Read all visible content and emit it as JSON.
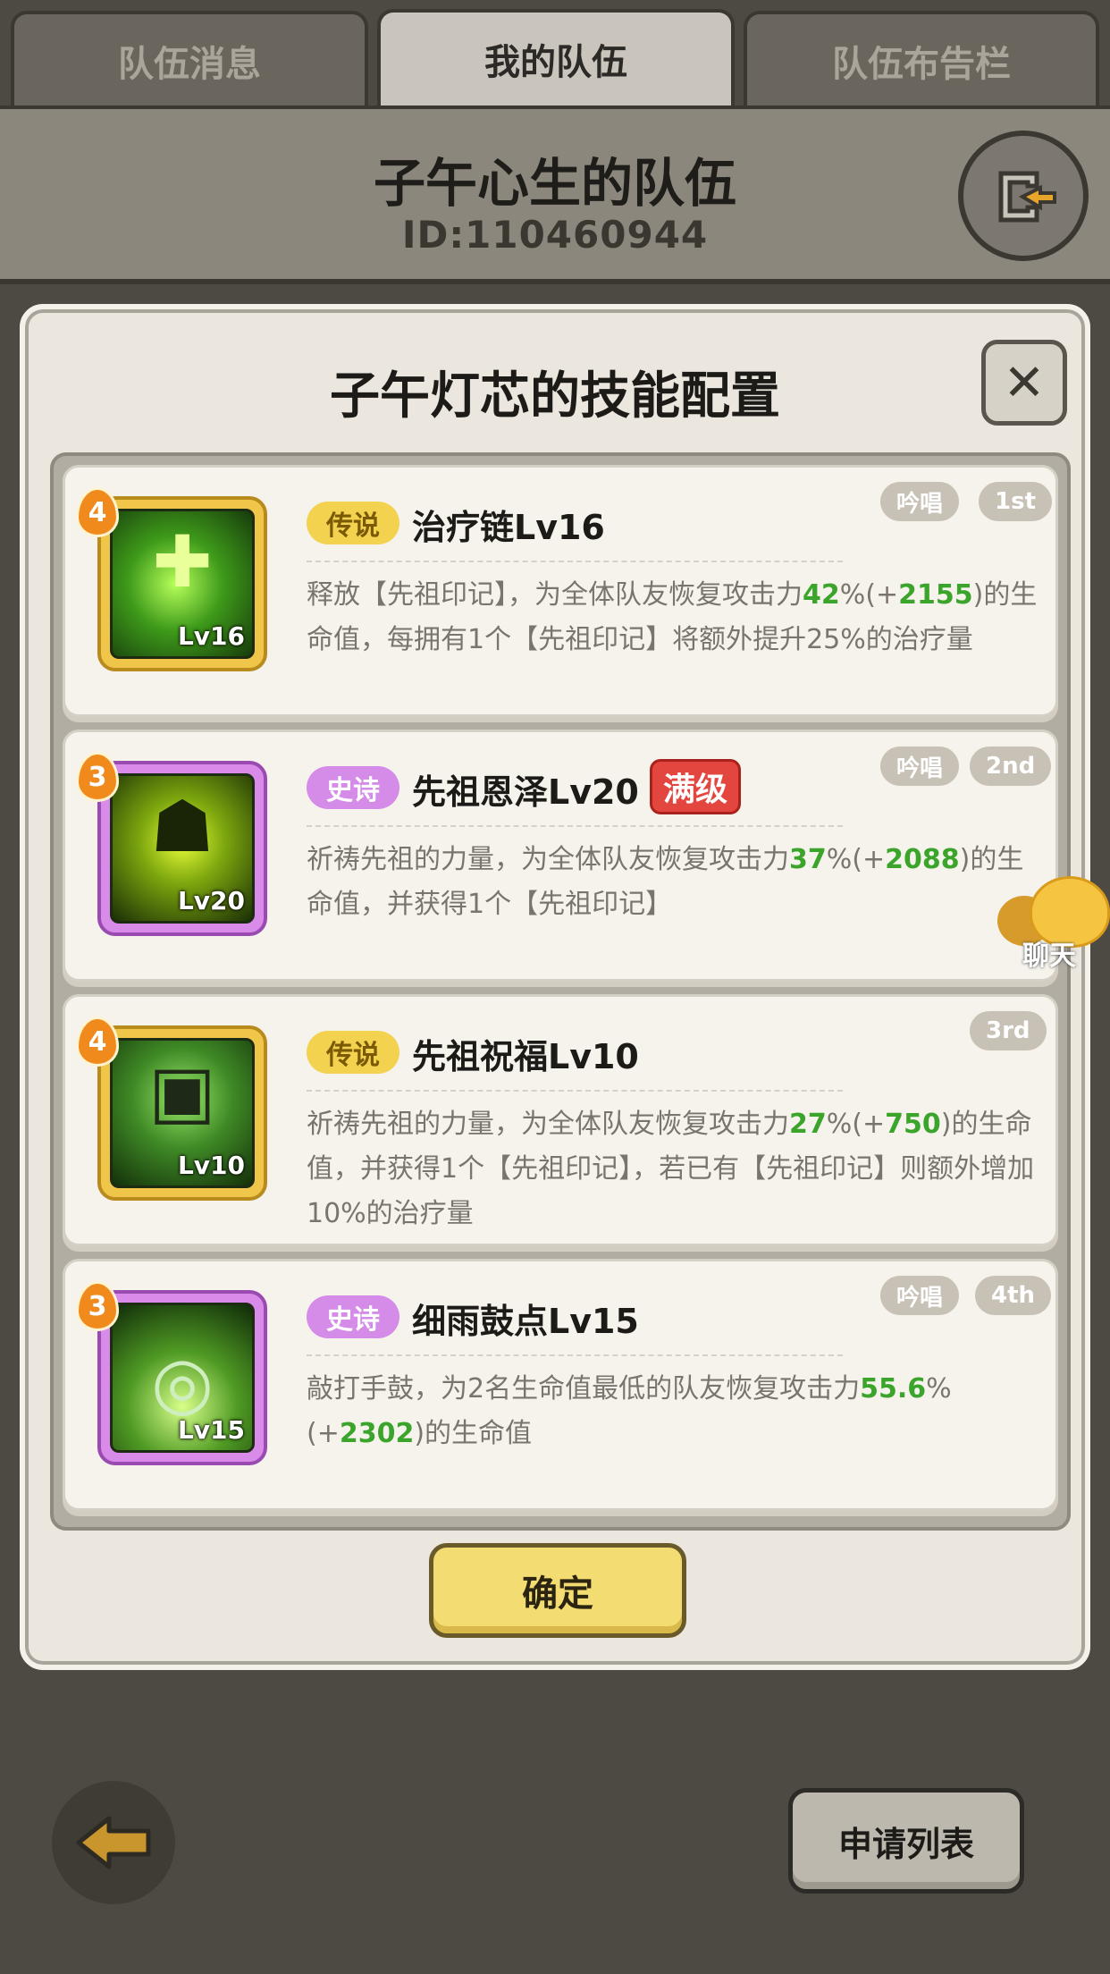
{
  "tabs": [
    {
      "label": "队伍消息",
      "active": false
    },
    {
      "label": "我的队伍",
      "active": true
    },
    {
      "label": "队伍布告栏",
      "active": false
    }
  ],
  "header": {
    "team_name": "子午心生的队伍",
    "team_id": "ID:110460944"
  },
  "modal": {
    "title": "子午灯芯的技能配置",
    "confirm_label": "确定"
  },
  "skills": [
    {
      "stars": "4",
      "level": "Lv16",
      "rarity": "传说",
      "name": "治疗链Lv16",
      "tags": [
        "吟唱",
        "1st"
      ],
      "desc_parts": [
        "释放【先祖印记】，为全体队友恢复攻击力",
        "42",
        "%(+",
        "2155",
        ")的生命值，每拥有1个【先祖印记】将额外提升25%的治疗量"
      ]
    },
    {
      "stars": "3",
      "level": "Lv20",
      "rarity": "史诗",
      "name": "先祖恩泽Lv20",
      "max_badge": "满级",
      "tags": [
        "吟唱",
        "2nd"
      ],
      "desc_parts": [
        "祈祷先祖的力量，为全体队友恢复攻击力",
        "37",
        "%(+",
        "2088",
        ")的生命值，并获得1个【先祖印记】"
      ]
    },
    {
      "stars": "4",
      "level": "Lv10",
      "rarity": "传说",
      "name": "先祖祝福Lv10",
      "tags": [
        "3rd"
      ],
      "desc_parts": [
        "祈祷先祖的力量，为全体队友恢复攻击力",
        "27",
        "%(+",
        "750",
        ")的生命值，并获得1个【先祖印记】，若已有【先祖印记】则额外增加10%的治疗量"
      ]
    },
    {
      "stars": "3",
      "level": "Lv15",
      "rarity": "史诗",
      "name": "细雨鼓点Lv15",
      "tags": [
        "吟唱",
        "4th"
      ],
      "desc_parts": [
        "敲打手鼓，为2名生命值最低的队友恢复攻击力",
        "55.6",
        "%(+",
        "2302",
        ")的生命值"
      ]
    }
  ],
  "chat": {
    "label": "聊天"
  },
  "bottom": {
    "apply_list_label": "申请列表"
  },
  "icons": {
    "exit": "exit-door-arrow-icon",
    "close": "close-x-icon",
    "back": "back-arrow-icon",
    "chat": "chat-bubble-mascot-icon"
  }
}
